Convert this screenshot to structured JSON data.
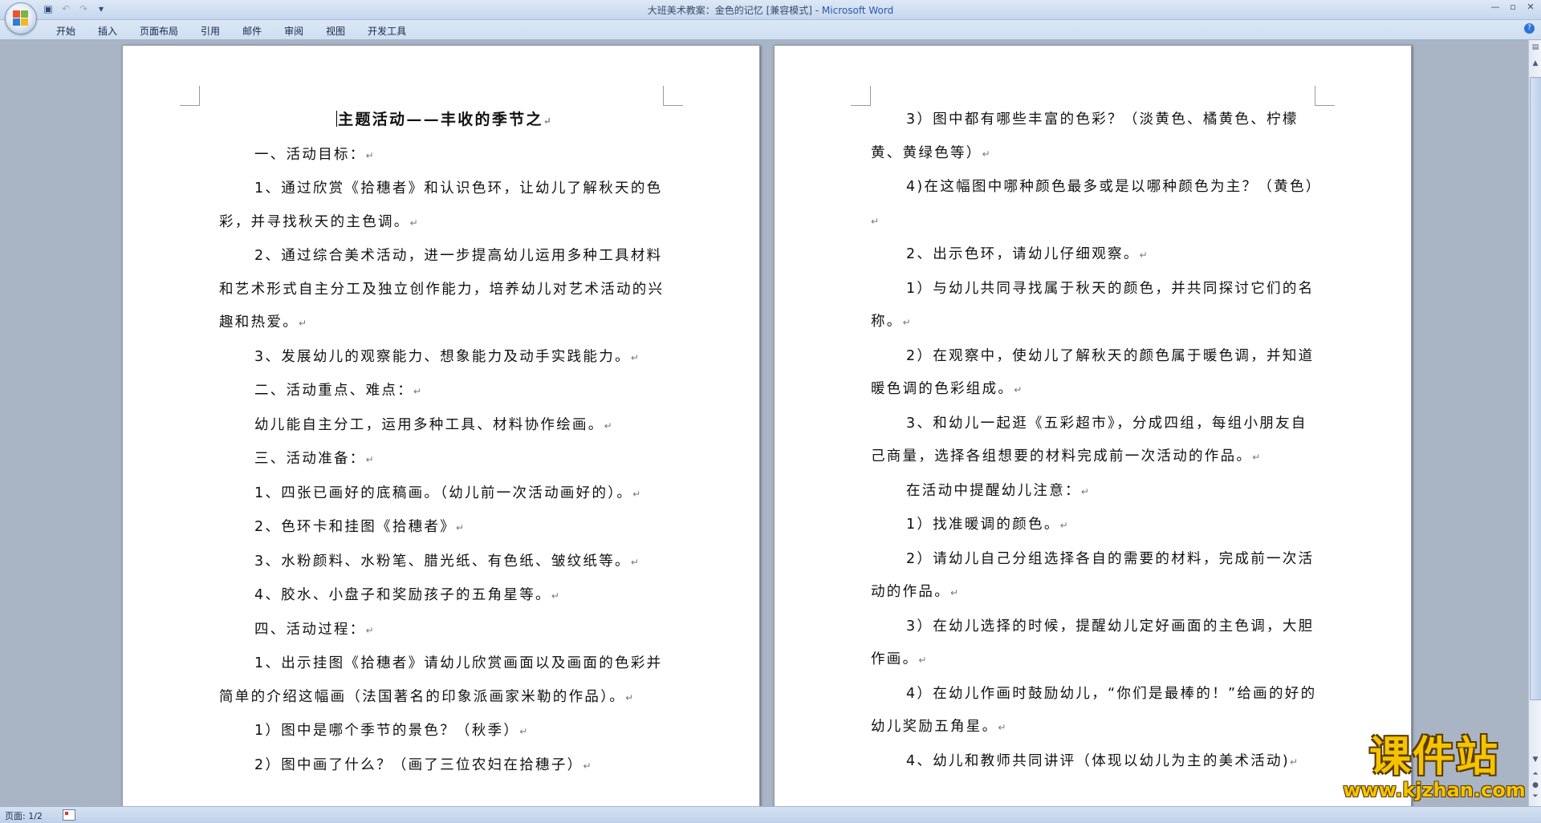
{
  "window": {
    "title": "大班美术教案：金色的记忆 [兼容模式] - ",
    "app_name": "Microsoft Word",
    "controls": [
      "minimize",
      "restore",
      "close"
    ]
  },
  "quick_access": [
    "save-icon",
    "undo-icon",
    "redo-icon",
    "customize-icon"
  ],
  "ribbon": {
    "tabs": [
      "开始",
      "插入",
      "页面布局",
      "引用",
      "邮件",
      "审阅",
      "视图",
      "开发工具"
    ]
  },
  "page1": {
    "title": "主题活动——丰收的季节之",
    "paragraphs": [
      "一、活动目标：",
      "1、通过欣赏《拾穗者》和认识色环，让幼儿了解秋天的色彩，并寻找秋天的主色调。",
      "2、通过综合美术活动，进一步提高幼儿运用多种工具材料和艺术形式自主分工及独立创作能力，培养幼儿对艺术活动的兴趣和热爱。",
      "3、发展幼儿的观察能力、想象能力及动手实践能力。",
      "二、活动重点、难点：",
      "幼儿能自主分工，运用多种工具、材料协作绘画。",
      "三、活动准备：",
      "1、四张已画好的底稿画。（幼儿前一次活动画好的）。",
      "2、色环卡和挂图《拾穗者》",
      "3、水粉颜料、水粉笔、腊光纸、有色纸、皱纹纸等。",
      "4、胶水、小盘子和奖励孩子的五角星等。",
      "四、活动过程：",
      "1、出示挂图《拾穗者》请幼儿欣赏画面以及画面的色彩并简单的介绍这幅画（法国著名的印象派画家米勒的作品）。",
      "1）图中是哪个季节的景色？（秋季）",
      "2）图中画了什么？（画了三位农妇在拾穗子）"
    ]
  },
  "page2": {
    "paragraphs": [
      "3）图中都有哪些丰富的色彩？（淡黄色、橘黄色、柠檬黄、黄绿色等）",
      "4)在这幅图中哪种颜色最多或是以哪种颜色为主？（黄色）",
      "2、出示色环，请幼儿仔细观察。",
      "1）与幼儿共同寻找属于秋天的颜色，并共同探讨它们的名称。",
      "2）在观察中，使幼儿了解秋天的颜色属于暖色调，并知道暖色调的色彩组成。",
      "3、和幼儿一起逛《五彩超市》，分成四组，每组小朋友自己商量，选择各组想要的材料完成前一次活动的作品。",
      "在活动中提醒幼儿注意：",
      "1）找准暖调的颜色。",
      "2）请幼儿自己分组选择各自的需要的材料，完成前一次活动的作品。",
      "3）在幼儿选择的时候，提醒幼儿定好画面的主色调，大胆作画。",
      "4）在幼儿作画时鼓励幼儿，“你们是最棒的！”给画的好的幼儿奖励五角星。",
      "4、幼儿和教师共同讲评（体现以幼儿为主的美术活动)"
    ]
  },
  "paragraph_mark": "↵",
  "status": {
    "page": "页面: 1/2"
  },
  "watermark": {
    "title": "课件站",
    "url": "www.kjzhan.com"
  },
  "colors": {
    "title_app": "#2a5aa8",
    "watermark": "#f5c400",
    "workspace": "#a9b4c5"
  }
}
